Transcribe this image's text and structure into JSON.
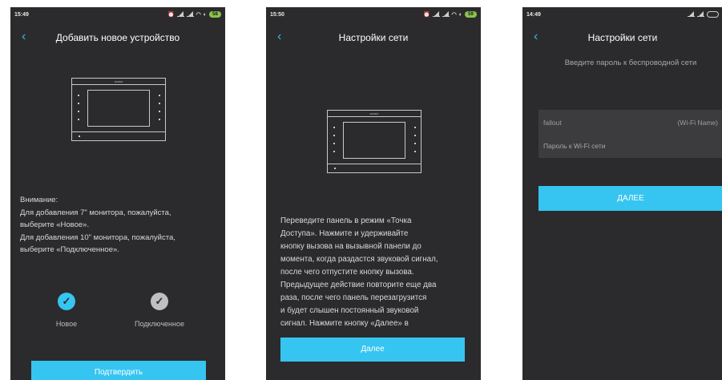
{
  "colors": {
    "background": "#2b2b2d",
    "accent": "#36c5f0",
    "selected_check": "#36c5f0",
    "unselected_check": "#c0c0c0"
  },
  "screen1": {
    "time": "15:49",
    "battery": "58",
    "title": "Добавить новое устройство",
    "back_icon": "chevron-left-icon",
    "device_brand": "SLINEX",
    "notice_lines": [
      "Внимание:",
      "Для добавления 7\" монитора, пожалуйста,",
      "выберите «Новое».",
      "Для добавления 10\" монитора, пожалуйста,",
      "выберите «Подключенное»."
    ],
    "options": [
      {
        "label": "Новое",
        "icon": "check-circle-icon",
        "selected": true
      },
      {
        "label": "Подключенное",
        "icon": "check-circle-icon",
        "selected": false
      }
    ],
    "confirm_label": "Подтвердить"
  },
  "screen2": {
    "time": "15:50",
    "battery": "59",
    "title": "Настройки сети",
    "back_icon": "chevron-left-icon",
    "device_brand": "SLINEX",
    "instruction_lines": [
      "Переведите панель в режим «Точка",
      "Доступа». Нажмите и удерживайте",
      "кнопку вызова на вызывной панели до",
      "момента, когда раздастся звуковой сигнал,",
      "после чего отпустите кнопку вызова.",
      "Предыдущее действие повторите еще два",
      "раза, после чего панель перезагрузится",
      "и будет слышен постоянный звуковой",
      "сигнал. Нажмите кнопку «Далее» в"
    ],
    "next_label": "Далее"
  },
  "screen3": {
    "time": "14:49",
    "title": "Настройки сети",
    "back_icon": "chevron-left-icon",
    "prompt": "Введите пароль к беспроводной сети",
    "ssid_value": "fallout",
    "ssid_hint": "(Wi-Fi Name)",
    "password_placeholder": "Пароль к Wi-Fi сети",
    "next_label": "ДАЛЕЕ"
  }
}
